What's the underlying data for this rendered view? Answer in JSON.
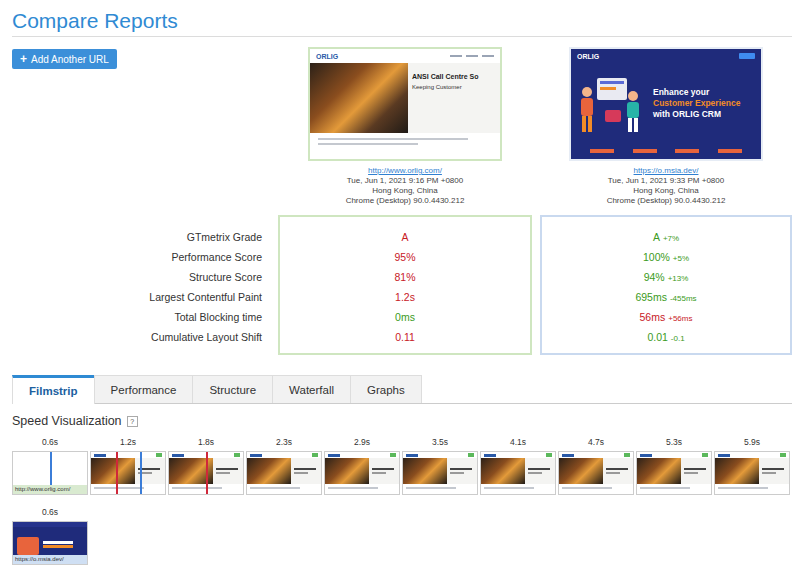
{
  "page": {
    "title": "Compare Reports"
  },
  "add_button": {
    "icon": "+",
    "label": "Add Another URL"
  },
  "reports": [
    {
      "url": "http://www.orlig.com/",
      "date": "Tue, Jun 1, 2021 9:16 PM +0800",
      "location": "Hong Kong, China",
      "browser": "Chrome (Desktop) 90.0.4430.212",
      "thumbnail": {
        "kind": "light",
        "logo": "ORLIG",
        "headline": [
          {
            "text": "ANSI Call Centre So",
            "color": "#1e1e1e"
          },
          {
            "text": "Keeping Customer",
            "color": "#333333"
          }
        ]
      }
    },
    {
      "url": "https://o.msia.dev/",
      "date": "Tue, Jun 1, 2021 9:33 PM +0800",
      "location": "Hong Kong, China",
      "browser": "Chrome (Desktop) 90.0.4430.212",
      "thumbnail": {
        "kind": "dark",
        "logo": "ORLIG",
        "headline": [
          {
            "text": "Enhance your",
            "color": "#ffffff"
          },
          {
            "text": "Customer Experience",
            "color": "#f28c28"
          },
          {
            "text": "with ORLIG CRM",
            "color": "#ffffff"
          }
        ]
      }
    }
  ],
  "metrics": [
    {
      "label": "GTmetrix Grade",
      "values": [
        {
          "text": "A",
          "color": "#c8201f"
        },
        {
          "text": "A",
          "color": "#3b9b22",
          "delta": {
            "text": "+7%",
            "color": "#3b9b22"
          }
        }
      ]
    },
    {
      "label": "Performance Score",
      "values": [
        {
          "text": "95%",
          "color": "#c8201f"
        },
        {
          "text": "100%",
          "color": "#3b9b22",
          "delta": {
            "text": "+5%",
            "color": "#3b9b22"
          }
        }
      ]
    },
    {
      "label": "Structure Score",
      "values": [
        {
          "text": "81%",
          "color": "#c8201f"
        },
        {
          "text": "94%",
          "color": "#3b9b22",
          "delta": {
            "text": "+13%",
            "color": "#3b9b22"
          }
        }
      ]
    },
    {
      "label": "Largest Contentful Paint",
      "values": [
        {
          "text": "1.2s",
          "color": "#c8201f"
        },
        {
          "text": "695ms",
          "color": "#3b9b22",
          "delta": {
            "text": "-455ms",
            "color": "#3b9b22"
          }
        }
      ]
    },
    {
      "label": "Total Blocking time",
      "values": [
        {
          "text": "0ms",
          "color": "#3b9b22"
        },
        {
          "text": "56ms",
          "color": "#c8201f",
          "delta": {
            "text": "+56ms",
            "color": "#c8201f"
          }
        }
      ]
    },
    {
      "label": "Cumulative Layout Shift",
      "values": [
        {
          "text": "0.11",
          "color": "#c8201f"
        },
        {
          "text": "0.01",
          "color": "#3b9b22",
          "delta": {
            "text": "-0.1",
            "color": "#3b9b22"
          }
        }
      ]
    }
  ],
  "tabs": [
    {
      "label": "Filmstrip",
      "selected": true
    },
    {
      "label": "Performance",
      "selected": false
    },
    {
      "label": "Structure",
      "selected": false
    },
    {
      "label": "Waterfall",
      "selected": false
    },
    {
      "label": "Graphs",
      "selected": false
    }
  ],
  "speed": {
    "title": "Speed Visualization",
    "help": "?",
    "rows": [
      {
        "label": "http://www.orlig.com/",
        "color": "#d9ead0",
        "frames": [
          {
            "time": "0.6s",
            "kind": "blank",
            "markers": [
              {
                "color": "#3b7dd8"
              }
            ]
          },
          {
            "time": "1.2s",
            "kind": "page",
            "markers": [
              {
                "color": "#d0283a"
              },
              {
                "color": "#3b7dd8"
              }
            ]
          },
          {
            "time": "1.8s",
            "kind": "page",
            "markers": [
              {
                "color": "#d0283a"
              }
            ]
          },
          {
            "time": "2.3s",
            "kind": "page",
            "markers": []
          },
          {
            "time": "2.9s",
            "kind": "page",
            "markers": []
          },
          {
            "time": "3.5s",
            "kind": "page",
            "markers": []
          },
          {
            "time": "4.1s",
            "kind": "page",
            "markers": []
          },
          {
            "time": "4.7s",
            "kind": "page",
            "markers": []
          },
          {
            "time": "5.3s",
            "kind": "page",
            "markers": []
          },
          {
            "time": "5.9s",
            "kind": "page",
            "markers": []
          }
        ]
      },
      {
        "label": "https://o.msia.dev/",
        "color": "#cfdff3",
        "frames": [
          {
            "time": "0.6s",
            "kind": "dark",
            "markers": []
          }
        ]
      }
    ]
  }
}
